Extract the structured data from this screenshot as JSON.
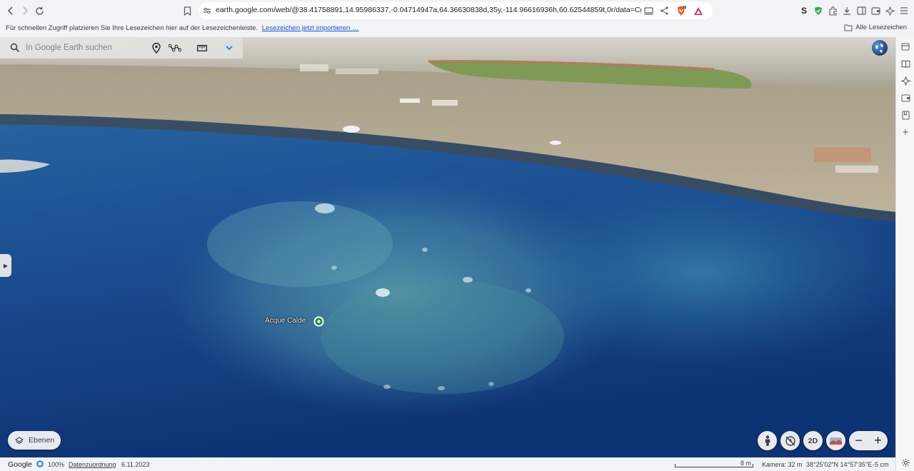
{
  "browser": {
    "url": "earth.google.com/web/@38.41758891,14.95986337,-0.04714947a,64.36630838d,35y,-114.96616936h,60.62544859t,0r/data=CgRCAggBO...",
    "bookmark_hint": "Für schnellen Zugriff platzieren Sie Ihre Lesezeichen hier auf der Lesezeichenleiste.",
    "bookmark_import_link": "Lesezeichen jetzt importieren …",
    "all_bookmarks": "Alle Lesezeichen",
    "shield_badge": "1"
  },
  "earth": {
    "search_placeholder": "In Google Earth suchen",
    "place_label": "Acque Calde",
    "layers_button": "Ebenen",
    "view_mode_button": "2D"
  },
  "status": {
    "brand": "Google",
    "zoom_percent": "100%",
    "attribution_link": "Datenzuordnung",
    "imagery_date": "6.11.2023",
    "scale_label": "8 m",
    "camera": "Kamera: 32 m",
    "coordinates": "38°25'02\"N 14°57'35\"E",
    "elevation": "-5 cm"
  },
  "colors": {
    "accent_blue": "#1a73e8",
    "pin_green": "#1e8e3e",
    "sea_deep": "#0f3a7c",
    "sea_shallow": "#3f8fa8",
    "beach_sand": "#b8ab90"
  }
}
